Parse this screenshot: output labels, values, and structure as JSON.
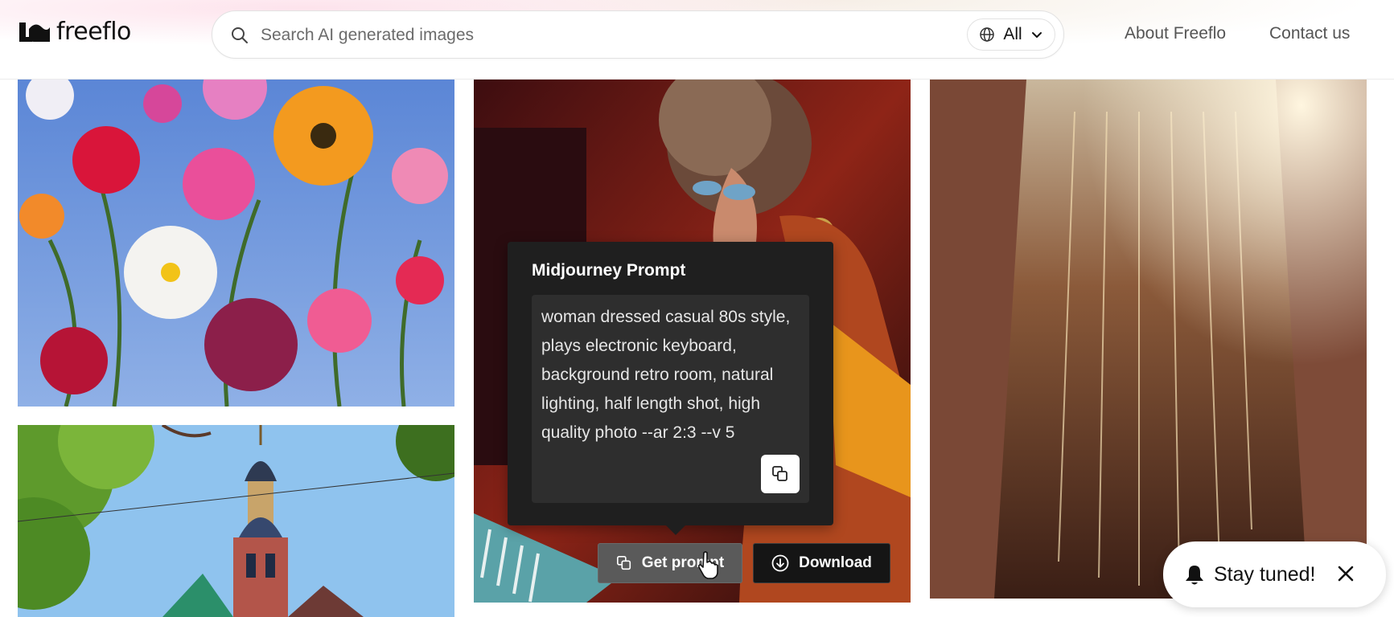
{
  "header": {
    "logo_text": "freeflo",
    "search": {
      "placeholder": "Search AI generated images",
      "value": ""
    },
    "filter": {
      "selected": "All",
      "icon": "globe-icon"
    },
    "nav": {
      "about": "About Freeflo",
      "contact": "Contact us"
    }
  },
  "gallery": {
    "tiles": [
      {
        "subject": "flowers"
      },
      {
        "subject": "building"
      },
      {
        "subject": "woman-keyboard"
      },
      {
        "subject": "sequin-dress"
      }
    ]
  },
  "prompt_popover": {
    "title": "Midjourney Prompt",
    "text": "woman dressed casual 80s style, plays electronic keyboard, background retro room, natural lighting, half length shot, high quality photo --ar 2:3 --v 5",
    "copy_icon": "copy-icon"
  },
  "actions": {
    "get_prompt": "Get prompt",
    "download": "Download"
  },
  "toast": {
    "text": "Stay tuned!",
    "icon": "bell-icon"
  },
  "colors": {
    "popover_bg": "#1f1f1f",
    "prompt_box_bg": "#2e2e2e",
    "get_prompt_bg": "#5a5a5a",
    "download_bg": "#151515"
  }
}
